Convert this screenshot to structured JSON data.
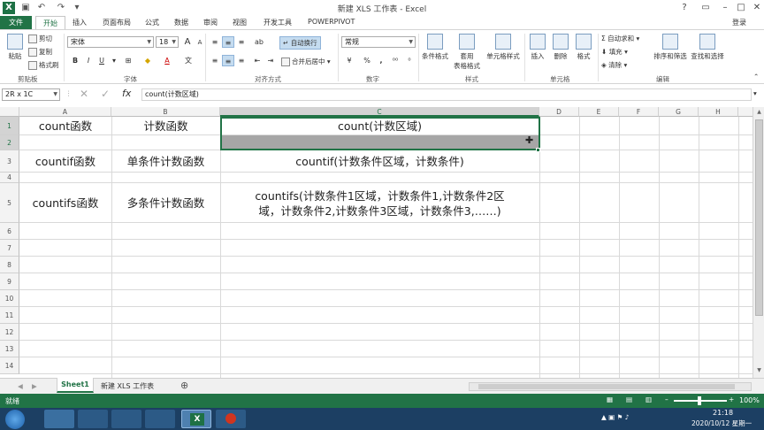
{
  "window": {
    "title": "新建 XLS 工作表 - Excel",
    "help": "?",
    "login": "登录"
  },
  "tabs": {
    "file": "文件",
    "items": [
      "开始",
      "插入",
      "页面布局",
      "公式",
      "数据",
      "审阅",
      "视图",
      "开发工具",
      "POWERPIVOT"
    ]
  },
  "ribbon": {
    "clipboard": {
      "paste": "粘贴",
      "cut": "剪切",
      "copy": "复制",
      "format_painter": "格式刷",
      "label": "剪贴板"
    },
    "font": {
      "name": "宋体",
      "size": "18",
      "bold": "B",
      "italic": "I",
      "underline": "U",
      "label": "字体",
      "grow": "A",
      "shrink": "A",
      "wen": "文"
    },
    "alignment": {
      "wrap": "自动换行",
      "merge": "合并后居中",
      "label": "对齐方式"
    },
    "number": {
      "format": "常规",
      "percent": "%",
      "comma": ",",
      "label": "数字"
    },
    "styles": {
      "conditional": "条件格式",
      "table": "套用\n表格格式",
      "cell_styles": "单元格样式",
      "label": "样式"
    },
    "cells": {
      "insert": "插入",
      "delete": "删除",
      "format": "格式",
      "label": "单元格"
    },
    "editing": {
      "autosum": "自动求和",
      "fill": "填充",
      "clear": "清除",
      "sort": "排序和筛选",
      "find": "查找和选择",
      "label": "编辑"
    }
  },
  "formula_bar": {
    "name_box": "2R x 1C",
    "fx": "fx",
    "content": "count(计数区域)"
  },
  "columns": [
    "A",
    "B",
    "C",
    "D",
    "E",
    "F",
    "G",
    "H"
  ],
  "rows": [
    "1",
    "2",
    "3",
    "4",
    "5",
    "6",
    "7",
    "8",
    "9",
    "10",
    "11",
    "12",
    "13",
    "14"
  ],
  "cells": {
    "A1": "count函数",
    "B1": "计数函数",
    "C1": "count(计数区域)",
    "A3": "countif函数",
    "B3": "单条件计数函数",
    "C3": "countif(计数条件区域，计数条件)",
    "A5": "countifs函数",
    "B5": "多条件计数函数",
    "C5_line1": "countifs(计数条件1区域，计数条件1,计数条件2区",
    "C5_line2": "域，计数条件2,计数条件3区域，计数条件3,……)"
  },
  "sheets": {
    "active": "Sheet1",
    "other": "新建 XLS 工作表",
    "add": "⊕"
  },
  "status": {
    "ready": "就绪",
    "zoom": "100%"
  },
  "taskbar": {
    "time": "21:18",
    "date": "2020/10/12 星期一"
  },
  "colors": {
    "excel_green": "#217346",
    "taskbar": "#1c3f63",
    "selection_fill": "#a6a6a6"
  }
}
